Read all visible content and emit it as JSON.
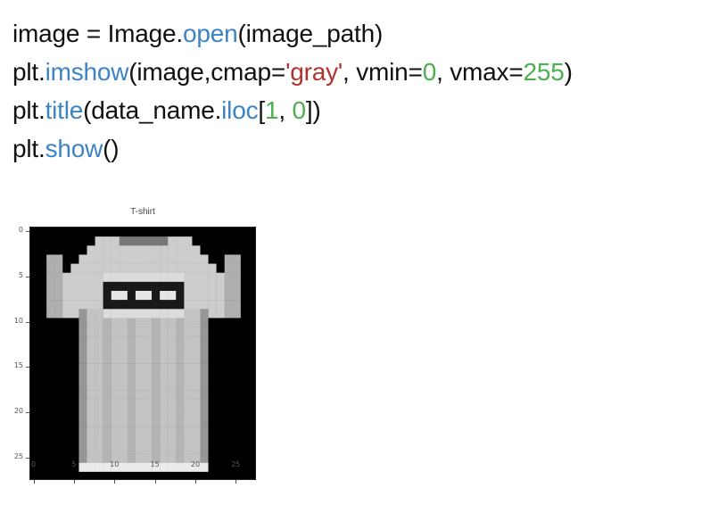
{
  "code": {
    "lines": [
      [
        {
          "t": "image = Image.",
          "c": "plain"
        },
        {
          "t": "open",
          "c": "func"
        },
        {
          "t": "(image_path)",
          "c": "plain"
        }
      ],
      [
        {
          "t": "plt.",
          "c": "plain"
        },
        {
          "t": "imshow",
          "c": "func"
        },
        {
          "t": "(image,cmap=",
          "c": "plain"
        },
        {
          "t": "'gray'",
          "c": "str"
        },
        {
          "t": ", vmin=",
          "c": "plain"
        },
        {
          "t": "0",
          "c": "num"
        },
        {
          "t": ", vmax=",
          "c": "plain"
        },
        {
          "t": "255",
          "c": "num"
        },
        {
          "t": ")",
          "c": "plain"
        }
      ],
      [
        {
          "t": "plt.",
          "c": "plain"
        },
        {
          "t": "title",
          "c": "func"
        },
        {
          "t": "(data_name.",
          "c": "plain"
        },
        {
          "t": "iloc",
          "c": "func"
        },
        {
          "t": "[",
          "c": "plain"
        },
        {
          "t": "1",
          "c": "num"
        },
        {
          "t": ", ",
          "c": "plain"
        },
        {
          "t": "0",
          "c": "num"
        },
        {
          "t": "])",
          "c": "plain"
        }
      ],
      [
        {
          "t": "plt.",
          "c": "plain"
        },
        {
          "t": "show",
          "c": "func"
        },
        {
          "t": "()",
          "c": "plain"
        }
      ]
    ],
    "colors": {
      "plain": "#111111",
      "func": "#3c84c4",
      "str": "#b0342c",
      "num": "#4caf50"
    }
  },
  "figure": {
    "title": "T-shirt",
    "y_ticks": [
      "0",
      "5",
      "10",
      "15",
      "20",
      "25"
    ],
    "x_ticks": [
      "0",
      "5",
      "10",
      "15",
      "20",
      "25"
    ],
    "image_grid_size": 28,
    "colormap": "gray"
  }
}
